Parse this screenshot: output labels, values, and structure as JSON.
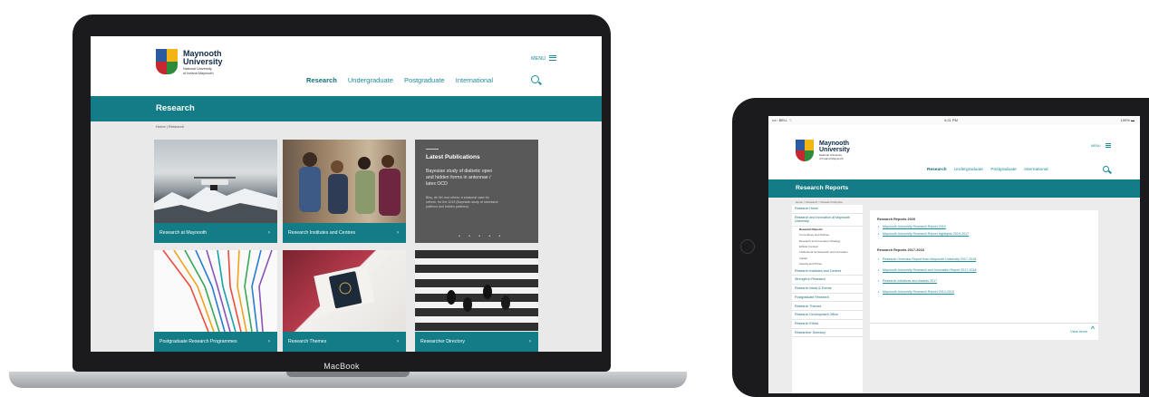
{
  "laptop": {
    "brand_label": "MacBook",
    "logo": {
      "name_line1": "Maynooth",
      "name_line2": "University",
      "sub_line1": "National University",
      "sub_line2": "of Ireland Maynooth"
    },
    "menu_label": "MENU",
    "nav": [
      "Research",
      "Undergraduate",
      "Postgraduate",
      "International"
    ],
    "band_title": "Research",
    "breadcrumb": "Home | Research",
    "tiles": [
      {
        "label": "Research at Maynooth"
      },
      {
        "label": "Research Institutes and Centres"
      },
      {
        "label": "Postgraduate Research Programmes"
      },
      {
        "label": "Research Themes"
      },
      {
        "label": "Researcher Directory"
      }
    ],
    "publications": {
      "title": "Latest Publications",
      "headline": "Bayesian study of diabetic open and hidden forms in antennae / latex OCD",
      "body": "Bley, de Vel and others: a seasonal case for refresh, for the 2019 (Bayesian study of obsessive patterns and hidden patterns)",
      "dots": "• • • • •"
    },
    "tile_arrow": "›"
  },
  "tablet": {
    "status": {
      "left": "•••○ BELL ⌔",
      "center": "4:21 PM",
      "right": "100% ▬"
    },
    "logo": {
      "name_line1": "Maynooth",
      "name_line2": "University",
      "sub_line1": "National University",
      "sub_line2": "of Ireland Maynooth"
    },
    "menu_label": "MENU",
    "nav": [
      "Research",
      "Undergraduate",
      "Postgraduate",
      "International"
    ],
    "band_title": "Research Reports",
    "breadcrumb": "Home > Research > Research Reports",
    "sidebar": [
      {
        "label": "Research Home",
        "sub": false
      },
      {
        "label": "Research and Innovation at Maynooth University",
        "sub": false
      },
      {
        "label": "Research Reports",
        "sub": true,
        "current": true
      },
      {
        "label": "Committees and Policies",
        "sub": true
      },
      {
        "label": "Research and Innovation Strategy",
        "sub": true
      },
      {
        "label": "Ethical Conduct",
        "sub": true
      },
      {
        "label": "Institutional for Research and Innovation",
        "sub": true
      },
      {
        "label": "Impact",
        "sub": true
      },
      {
        "label": "Awards and Prizes",
        "sub": true
      },
      {
        "label": "Research Institutes and Centres",
        "sub": false
      },
      {
        "label": "Strength in Research",
        "sub": false
      },
      {
        "label": "Research Ideas & Events",
        "sub": false
      },
      {
        "label": "Postgraduate Research",
        "sub": false
      },
      {
        "label": "Research Themes",
        "sub": false
      },
      {
        "label": "Research Development Office",
        "sub": false
      },
      {
        "label": "Research Ethics",
        "sub": false
      },
      {
        "label": "Researcher Directory",
        "sub": false
      }
    ],
    "main": {
      "section1_heading": "Research Reports 2020",
      "section1_links": [
        "Maynooth University Research Report 2019",
        "Maynooth University Research Report highlights 2019-2017"
      ],
      "section2_heading": "Research Reports 2017-2018",
      "section2_links": [
        "Research Overview Report from Maynooth University 2017-2018",
        "Maynooth University Research and Innovation Report 2017-2018",
        "Research Initiatives and Awards 2017",
        "Maynooth University Research Report 2014-2015"
      ]
    },
    "view_more": "View more",
    "view_more_glyph": "^"
  }
}
